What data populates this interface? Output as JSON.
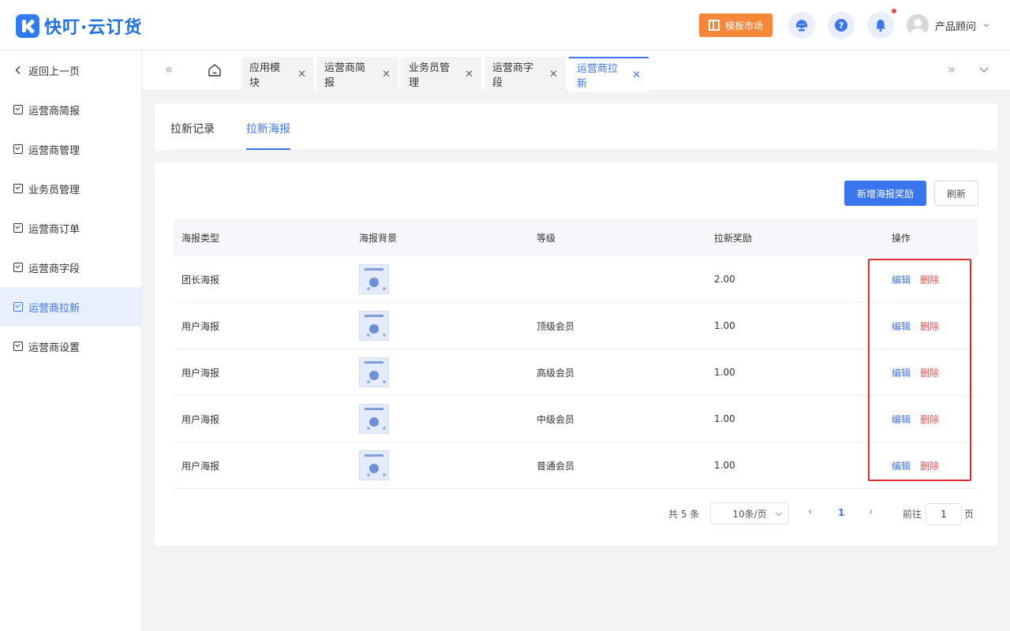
{
  "header": {
    "logo_text": "快叮·云订货",
    "market_label": "模板市场",
    "user_name": "产品顾问"
  },
  "sidebar": {
    "back_label": "返回上一页",
    "items": [
      {
        "label": "运营商简报"
      },
      {
        "label": "运营商管理"
      },
      {
        "label": "业务员管理"
      },
      {
        "label": "运营商订单"
      },
      {
        "label": "运营商字段"
      },
      {
        "label": "运营商拉新",
        "active": true
      },
      {
        "label": "运营商设置"
      }
    ]
  },
  "tabs": {
    "items": [
      {
        "label": "应用模块"
      },
      {
        "label": "运营商简报"
      },
      {
        "label": "业务员管理"
      },
      {
        "label": "运营商字段"
      },
      {
        "label": "运营商拉新",
        "active": true
      }
    ]
  },
  "subtabs": {
    "record_label": "拉新记录",
    "poster_label": "拉新海报"
  },
  "toolbar": {
    "add_label": "新增海报奖励",
    "refresh_label": "刷新"
  },
  "table": {
    "columns": [
      "海报类型",
      "海报背景",
      "等级",
      "拉新奖励",
      "操作"
    ],
    "rows": [
      {
        "type": "团长海报",
        "level": "",
        "reward": "2.00"
      },
      {
        "type": "用户海报",
        "level": "顶级会员",
        "reward": "1.00"
      },
      {
        "type": "用户海报",
        "level": "高级会员",
        "reward": "1.00"
      },
      {
        "type": "用户海报",
        "level": "中级会员",
        "reward": "1.00"
      },
      {
        "type": "用户海报",
        "level": "普通会员",
        "reward": "1.00"
      }
    ],
    "edit_label": "编辑",
    "delete_label": "删除"
  },
  "pagination": {
    "total_text": "共 5 条",
    "page_size": "10条/页",
    "current_page": "1",
    "goto_label": "前往",
    "goto_value": "1",
    "page_suffix": "页"
  },
  "colors": {
    "primary": "#3b74ef",
    "danger": "#f5484d",
    "market": "#f7873a",
    "highlight": "#e42a2a"
  }
}
